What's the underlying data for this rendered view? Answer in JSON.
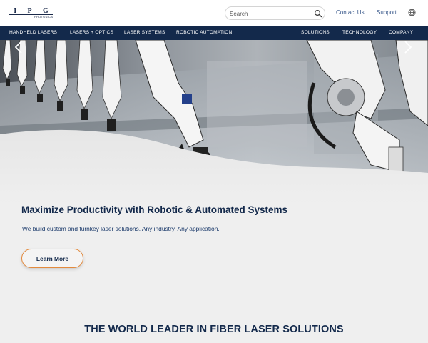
{
  "header": {
    "logo_text": [
      "I",
      "P",
      "G"
    ],
    "logo_subtext": "PHOTONICS",
    "search": {
      "placeholder": "Search"
    },
    "links": [
      "Contact Us",
      "Support"
    ]
  },
  "nav": {
    "left": [
      "HANDHELD LASERS",
      "LASERS + OPTICS",
      "LASER SYSTEMS",
      "ROBOTIC AUTOMATION"
    ],
    "right": [
      "SOLUTIONS",
      "TECHNOLOGY",
      "COMPANY"
    ]
  },
  "hero": {
    "image": "robotic-arms-production-line"
  },
  "content": {
    "headline": "Maximize Productivity with Robotic & Automated Systems",
    "subline": "We build custom and turnkey laser solutions. Any industry. Any application.",
    "cta_label": "Learn More",
    "tagline": "THE WORLD LEADER IN FIBER LASER SOLUTIONS"
  },
  "colors": {
    "navy": "#13294b",
    "accent_orange": "#e38a3d",
    "link_blue": "#3b5a8c",
    "page_bg": "#efefef"
  }
}
